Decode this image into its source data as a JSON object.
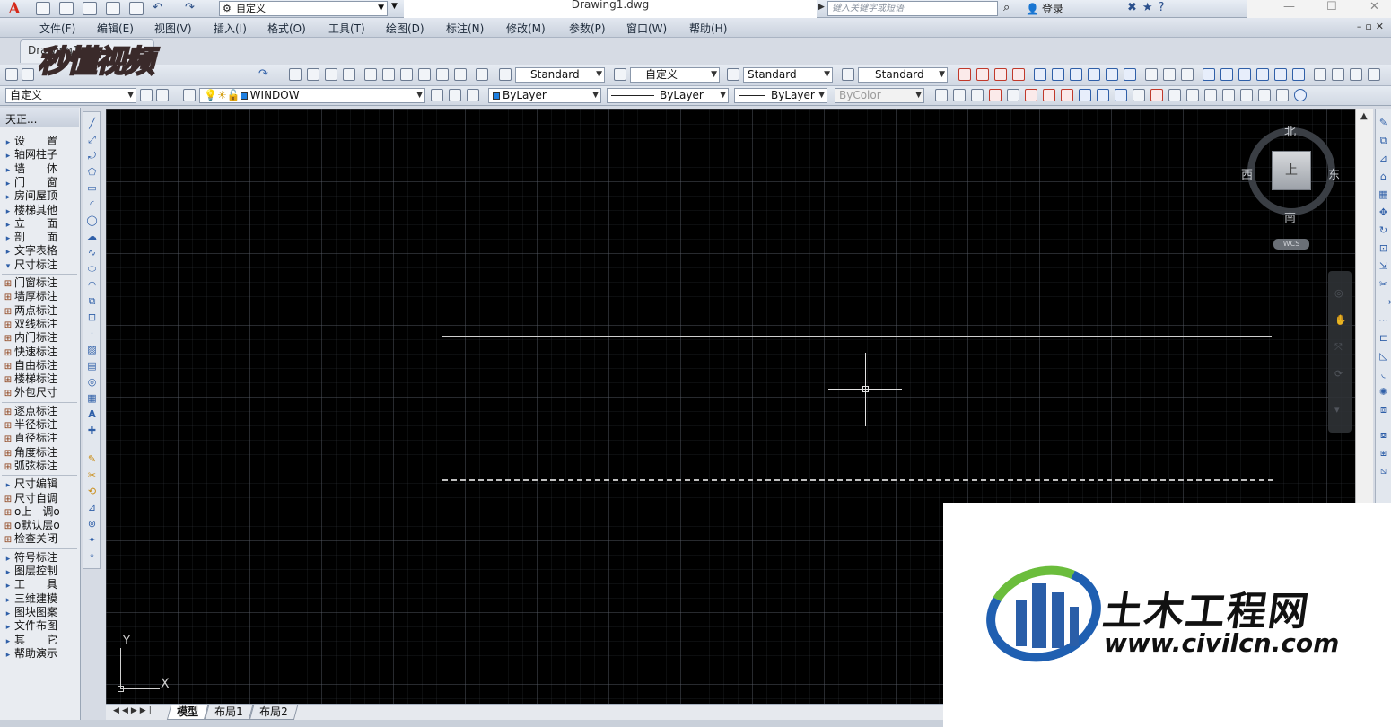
{
  "titlebar": {
    "workspace": "自定义",
    "doc_title": "Drawing1.dwg",
    "search_placeholder": "键入关键字或短语",
    "login": "登录"
  },
  "menu": [
    "文件(F)",
    "编辑(E)",
    "视图(V)",
    "插入(I)",
    "格式(O)",
    "工具(T)",
    "绘图(D)",
    "标注(N)",
    "修改(M)",
    "参数(P)",
    "窗口(W)",
    "帮助(H)"
  ],
  "doc_tab": "Drawing1",
  "video_logo": "秒懂视频",
  "styles_toolbar": {
    "text_style": "Standard",
    "dim_style": "自定义",
    "table_style": "Standard",
    "multileader_style": "Standard"
  },
  "layers_toolbar": {
    "workspace": "自定义",
    "layer": "WINDOW",
    "color": "ByLayer",
    "linetype": "ByLayer",
    "lineweight": "ByLayer",
    "plotstyle": "ByColor"
  },
  "tz_panel": {
    "title": "天正...",
    "items": [
      {
        "mark": "▸",
        "label": "设　　置"
      },
      {
        "mark": "▸",
        "label": "轴网柱子"
      },
      {
        "mark": "▸",
        "label": "墙　　体"
      },
      {
        "mark": "▸",
        "label": "门　　窗"
      },
      {
        "mark": "▸",
        "label": "房间屋顶"
      },
      {
        "mark": "▸",
        "label": "楼梯其他"
      },
      {
        "mark": "▸",
        "label": "立　　面"
      },
      {
        "mark": "▸",
        "label": "剖　　面"
      },
      {
        "mark": "▸",
        "label": "文字表格"
      },
      {
        "mark": "▾",
        "label": "尺寸标注"
      },
      {
        "mark": "",
        "label": "门窗标注"
      },
      {
        "mark": "",
        "label": "墙厚标注"
      },
      {
        "mark": "",
        "label": "两点标注"
      },
      {
        "mark": "",
        "label": "双线标注"
      },
      {
        "mark": "",
        "label": "内门标注"
      },
      {
        "mark": "",
        "label": "快速标注"
      },
      {
        "mark": "",
        "label": "自由标注"
      },
      {
        "mark": "",
        "label": "楼梯标注"
      },
      {
        "mark": "",
        "label": "外包尺寸"
      },
      {
        "mark": "",
        "label": "逐点标注"
      },
      {
        "mark": "",
        "label": "半径标注"
      },
      {
        "mark": "",
        "label": "直径标注"
      },
      {
        "mark": "",
        "label": "角度标注"
      },
      {
        "mark": "",
        "label": "弧弦标注"
      },
      {
        "mark": "▸",
        "label": "尺寸编辑"
      },
      {
        "mark": "",
        "label": "尺寸自调"
      },
      {
        "mark": "",
        "label": "o上　调o"
      },
      {
        "mark": "",
        "label": "o默认层o"
      },
      {
        "mark": "",
        "label": "检查关闭"
      },
      {
        "mark": "▸",
        "label": "符号标注"
      },
      {
        "mark": "▸",
        "label": "图层控制"
      },
      {
        "mark": "▸",
        "label": "工　　具"
      },
      {
        "mark": "▸",
        "label": "三维建模"
      },
      {
        "mark": "▸",
        "label": "图块图案"
      },
      {
        "mark": "▸",
        "label": "文件布图"
      },
      {
        "mark": "▸",
        "label": "其　　它"
      },
      {
        "mark": "▸",
        "label": "帮助演示"
      }
    ]
  },
  "viewcube": {
    "north": "北",
    "south": "南",
    "east": "东",
    "west": "西",
    "face": "上",
    "wcs": "WCS"
  },
  "ucs": {
    "x": "X",
    "y": "Y"
  },
  "layout_tabs": [
    "模型",
    "布局1",
    "布局2"
  ],
  "watermark": {
    "title": "土木工程网",
    "url": "www.civilcn.com"
  }
}
